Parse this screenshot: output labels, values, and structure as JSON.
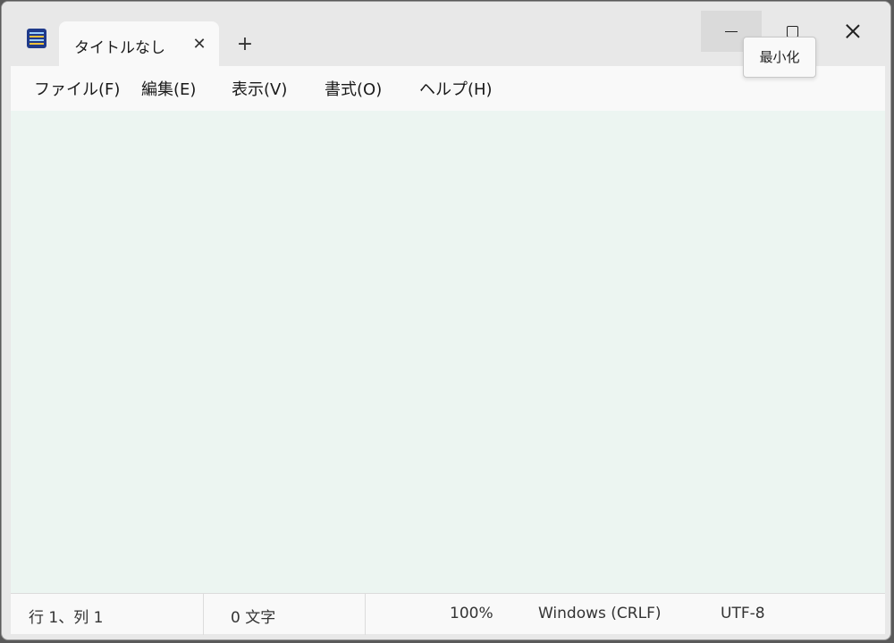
{
  "app": {
    "icon": "notepad-icon",
    "tab_title": "タイトルなし",
    "tab_close_glyph": "✕",
    "new_tab_glyph": "+"
  },
  "window_controls": {
    "minimize_icon": "minimize-icon",
    "maximize_icon": "maximize-icon",
    "close_icon": "close-icon",
    "tooltip": "最小化"
  },
  "menu": {
    "items": [
      "ファイル(F)",
      "編集(E)",
      "表示(V)",
      "書式(O)",
      "ヘルプ(H)"
    ]
  },
  "editor": {
    "content": "",
    "background": "#ecf5f1"
  },
  "status": {
    "position": "行 1、列 1",
    "chars": "0 文字",
    "zoom": "100%",
    "line_ending": "Windows (CRLF)",
    "encoding": "UTF-8"
  }
}
